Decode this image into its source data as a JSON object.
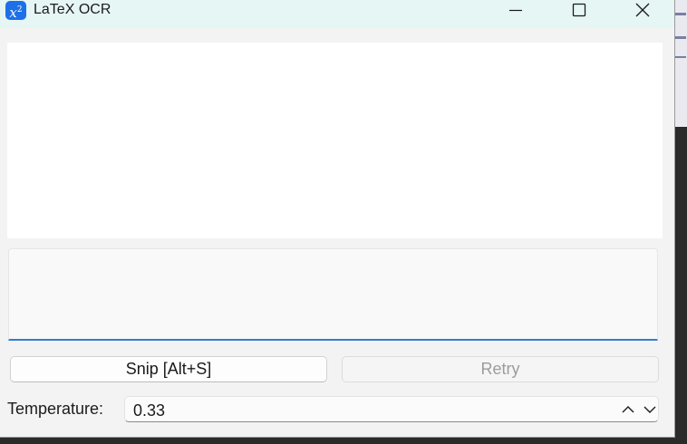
{
  "window": {
    "title": "LaTeX OCR",
    "icon": "x-squared-icon",
    "controls": [
      "minimize-icon",
      "maximize-icon",
      "close-icon"
    ]
  },
  "output": {
    "value": ""
  },
  "buttons": {
    "snip_label": "Snip [Alt+S]",
    "retry_label": "Retry"
  },
  "temperature": {
    "label": "Temperature:",
    "value": "0.33"
  },
  "colors": {
    "titlebar": "#e5f6f4",
    "accent": "#2f7fd0",
    "app_icon": "#1e70e8",
    "disabled_text": "#9c9c9c"
  }
}
